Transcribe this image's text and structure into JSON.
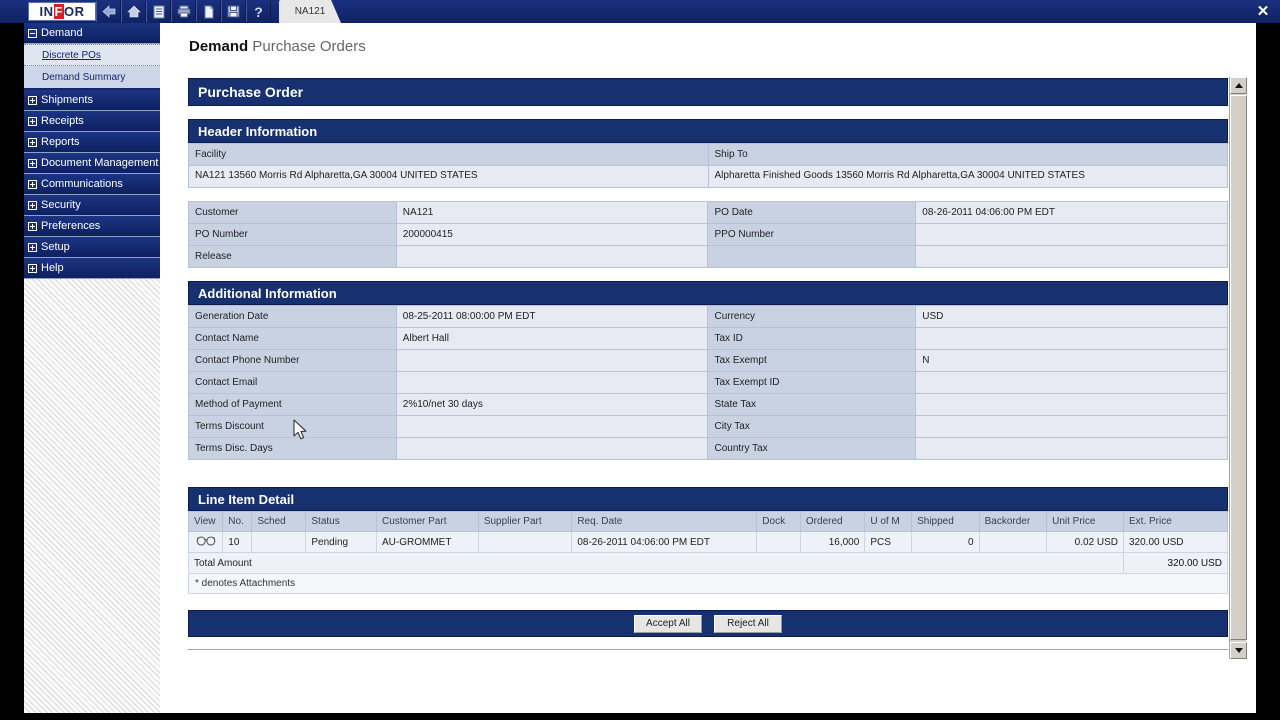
{
  "window": {
    "logo": "INFOR",
    "close_label": "✕",
    "tab_label": "NA121"
  },
  "toolbar": {
    "buttons": [
      {
        "name": "back-icon",
        "label": "Back"
      },
      {
        "name": "home-icon",
        "label": "Home"
      },
      {
        "name": "list-icon",
        "label": "List"
      },
      {
        "name": "print-icon",
        "label": "Print"
      },
      {
        "name": "document-icon",
        "label": "Document"
      },
      {
        "name": "save-icon",
        "label": "Save"
      },
      {
        "name": "help-icon",
        "label": "?"
      }
    ]
  },
  "sidebar": {
    "items": [
      {
        "label": "Demand",
        "expanded": true,
        "children": [
          {
            "label": "Discrete POs",
            "selected": true
          },
          {
            "label": "Demand Summary",
            "selected": false
          }
        ]
      },
      {
        "label": "Shipments",
        "expanded": false,
        "children": []
      },
      {
        "label": "Receipts",
        "expanded": false,
        "children": []
      },
      {
        "label": "Reports",
        "expanded": false,
        "children": []
      },
      {
        "label": "Document Management",
        "expanded": false,
        "children": []
      },
      {
        "label": "Communications",
        "expanded": false,
        "children": []
      },
      {
        "label": "Security",
        "expanded": false,
        "children": []
      },
      {
        "label": "Preferences",
        "expanded": false,
        "children": []
      },
      {
        "label": "Setup",
        "expanded": false,
        "children": []
      },
      {
        "label": "Help",
        "expanded": false,
        "children": []
      }
    ]
  },
  "page": {
    "title_bold": "Demand",
    "title_rest": " Purchase Orders",
    "panel_title": "Purchase Order"
  },
  "header_information": {
    "section_title": "Header Information",
    "facility_label": "Facility",
    "ship_to_label": "Ship To",
    "facility_address": "NA121\n13560 Morris Rd\nAlpharetta,GA 30004\nUNITED STATES",
    "ship_to_address": "Alpharetta Finished Goods\n13560 Morris Rd\nAlpharetta,GA 30004\nUNITED STATES",
    "fields": [
      {
        "label": "Customer",
        "value": "NA121",
        "label2": "PO Date",
        "value2": "08-26-2011 04:06:00 PM EDT"
      },
      {
        "label": "PO Number",
        "value": "200000415",
        "label2": "PPO Number",
        "value2": ""
      },
      {
        "label": "Release",
        "value": "",
        "label2": "",
        "value2": ""
      }
    ]
  },
  "additional_information": {
    "section_title": "Additional Information",
    "fields": [
      {
        "label": "Generation Date",
        "value": "08-25-2011 08:00:00 PM EDT",
        "label2": "Currency",
        "value2": "USD"
      },
      {
        "label": "Contact Name",
        "value": "Albert Hall",
        "label2": "Tax ID",
        "value2": ""
      },
      {
        "label": "Contact Phone Number",
        "value": "",
        "label2": "Tax Exempt",
        "value2": "N"
      },
      {
        "label": "Contact Email",
        "value": "",
        "label2": "Tax Exempt ID",
        "value2": ""
      },
      {
        "label": "Method of Payment",
        "value": "2%10/net 30 days",
        "label2": "State Tax",
        "value2": ""
      },
      {
        "label": "Terms Discount",
        "value": "",
        "label2": "City Tax",
        "value2": ""
      },
      {
        "label": "Terms Disc. Days",
        "value": "",
        "label2": "Country Tax",
        "value2": ""
      }
    ]
  },
  "line_item_detail": {
    "section_title": "Line Item Detail",
    "columns": [
      "View",
      "No.",
      "Sched",
      "Status",
      "Customer Part",
      "Supplier Part",
      "Req. Date",
      "Dock",
      "Ordered",
      "U of M",
      "Shipped",
      "Backorder",
      "Unit Price",
      "Ext. Price"
    ],
    "rows": [
      {
        "view_icon": "glasses-icon",
        "no": "10",
        "sched": "",
        "status": "Pending",
        "customer_part": "AU-GROMMET",
        "supplier_part": "",
        "req_date": "08-26-2011 04:06:00 PM EDT",
        "dock": "",
        "ordered": "16,000",
        "uom": "PCS",
        "shipped": "0",
        "backorder": "",
        "unit_price": "0.02 USD",
        "ext_price": "320.00 USD"
      }
    ],
    "total_label": "Total Amount",
    "total_value": "320.00 USD",
    "footnote": "* denotes Attachments"
  },
  "actions": {
    "accept_all": "Accept All",
    "reject_all": "Reject All"
  },
  "colors": {
    "brand_blue": "#17306f",
    "toolbar_blue": "#12276b",
    "label_cell": "#c9d2e3",
    "value_cell": "#e7eaf2"
  }
}
